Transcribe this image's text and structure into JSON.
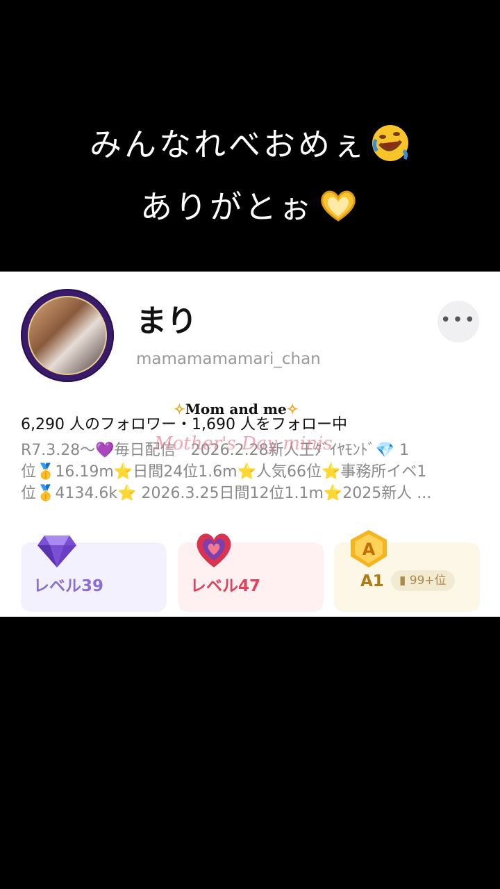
{
  "caption": {
    "line1": "みんなれべおめぇ",
    "line2": "ありがとぉ"
  },
  "profile": {
    "name": "まり",
    "handle": "mamamamamari_chan",
    "more_label": "•••",
    "follow_text": "6,290 人のフォロワー・1,690 人をフォロー中",
    "bio_lines": [
      "R7.3.28～💜毎日配信　2026.2.28新人王ﾀﾞｲﾔﾓﾝﾄﾞ💎 1",
      "位🥇16.19m⭐日間24位1.6m⭐人気66位⭐事務所イベ1",
      "位🥇4134.6k⭐ 2026.3.25日間12位1.1m⭐2025新人 ..."
    ]
  },
  "overlays": {
    "mom_and_me": "Mom and me",
    "mothers_day": "Mother's Day minis"
  },
  "badges": [
    {
      "icon": "diamond-icon",
      "label": "レベル39",
      "color": "#8a6fd1"
    },
    {
      "icon": "heart-gem-icon",
      "label": "レベル47",
      "color": "#e0415d"
    },
    {
      "icon": "a-rank-icon",
      "label": "A1",
      "rank": "99+位",
      "color": "#b07a12"
    }
  ]
}
